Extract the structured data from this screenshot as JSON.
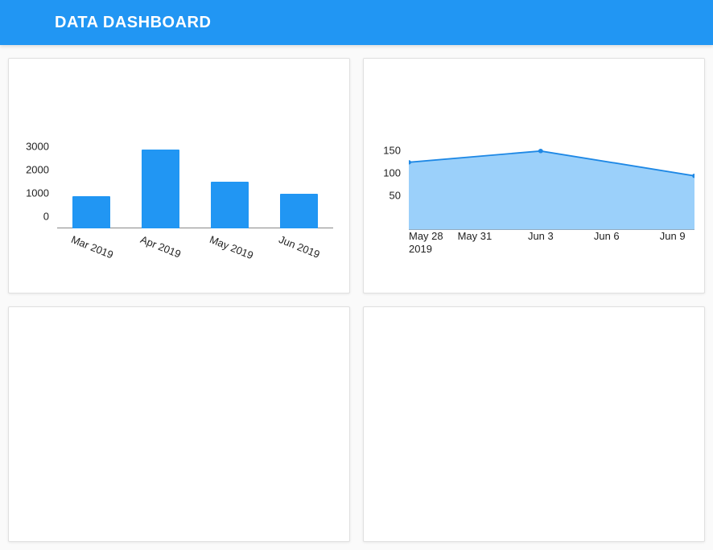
{
  "header": {
    "title": "DATA DASHBOARD"
  },
  "chart_data": [
    {
      "type": "bar",
      "categories": [
        "Mar 2019",
        "Apr 2019",
        "May 2019",
        "Jun 2019"
      ],
      "values": [
        1400,
        3400,
        2000,
        1500
      ],
      "y_ticks": [
        0,
        1000,
        2000,
        3000
      ],
      "ylim": [
        0,
        3500
      ],
      "title": "",
      "xlabel": "",
      "ylabel": ""
    },
    {
      "type": "area",
      "x_ticks": [
        "May 28",
        "May 31",
        "Jun 3",
        "Jun 6",
        "Jun 9"
      ],
      "x_year_label": "2019",
      "series": [
        {
          "name": "",
          "x": [
            "May 28",
            "Jun 3",
            "Jun 10"
          ],
          "values": [
            150,
            175,
            120
          ]
        }
      ],
      "y_ticks": [
        50,
        100,
        150
      ],
      "ylim": [
        0,
        180
      ],
      "xlim_dates": [
        "May 28",
        "Jun 10"
      ],
      "title": "",
      "xlabel": "",
      "ylabel": ""
    }
  ]
}
